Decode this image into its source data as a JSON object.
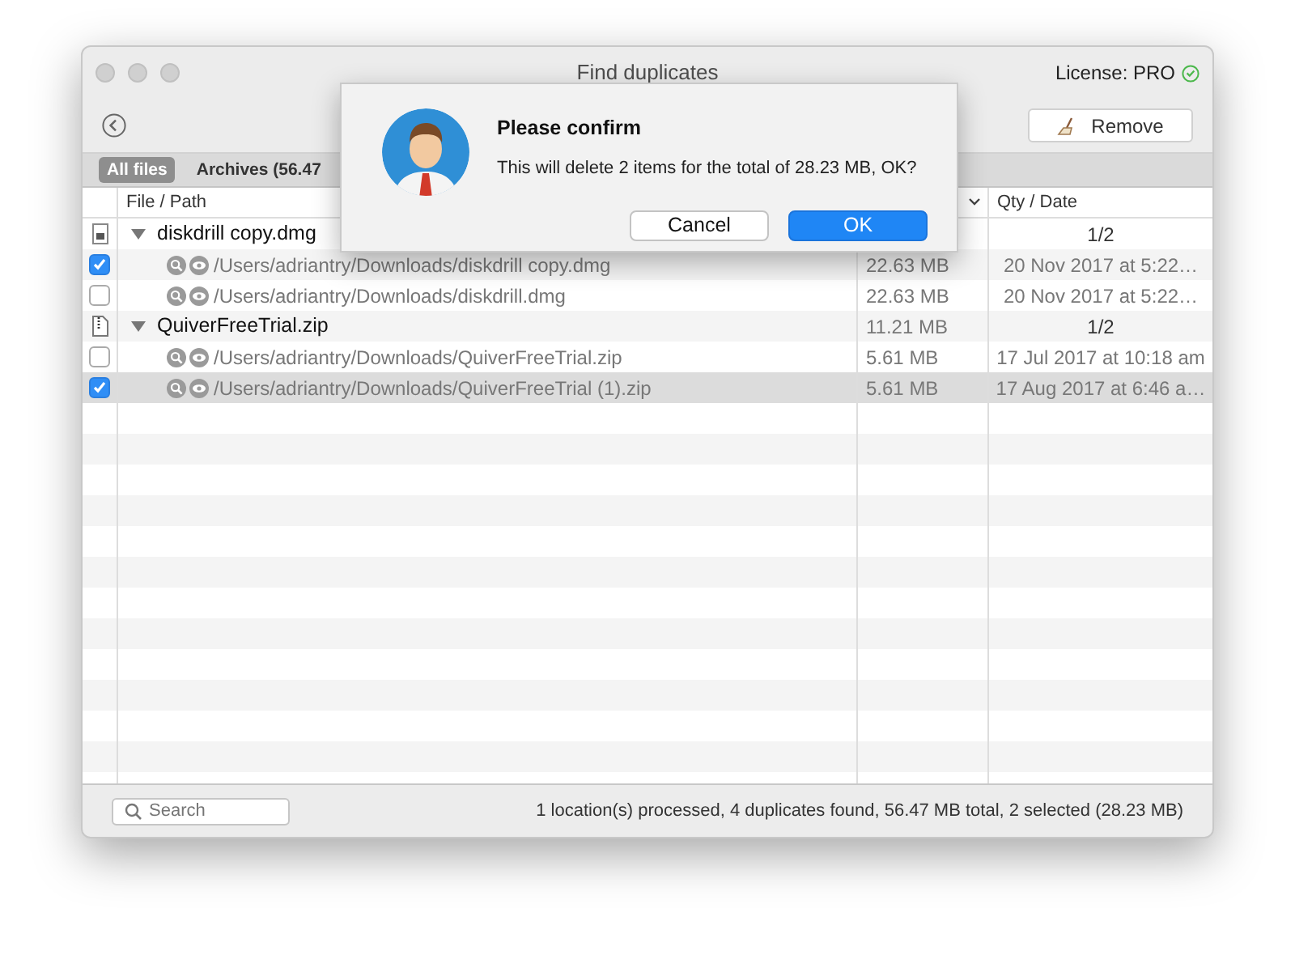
{
  "window": {
    "title": "Find duplicates",
    "license": "License: PRO"
  },
  "toolbar": {
    "remove_button": "Remove"
  },
  "tabs": [
    {
      "label": "All files",
      "selected": true
    },
    {
      "label": "Archives (56.47",
      "selected": false
    }
  ],
  "table": {
    "columns": {
      "path": "File / Path",
      "qty_date": "Qty / Date"
    },
    "rows": [
      {
        "kind": "dmg_group",
        "expanded": true,
        "name": "diskdrill copy.dmg",
        "qty": "1/2"
      },
      {
        "kind": "file",
        "checked": true,
        "selected": false,
        "path": "/Users/adriantry/Downloads/diskdrill copy.dmg",
        "size": "22.63 MB",
        "date": "20 Nov 2017 at 5:22…"
      },
      {
        "kind": "file",
        "checked": false,
        "selected": false,
        "path": "/Users/adriantry/Downloads/diskdrill.dmg",
        "size": "22.63 MB",
        "date": "20 Nov 2017 at 5:22…"
      },
      {
        "kind": "zip_group",
        "expanded": true,
        "name": "QuiverFreeTrial.zip",
        "size": "11.21 MB",
        "qty": "1/2"
      },
      {
        "kind": "file",
        "checked": false,
        "selected": false,
        "path": "/Users/adriantry/Downloads/QuiverFreeTrial.zip",
        "size": "5.61 MB",
        "date": "17 Jul 2017 at 10:18 am"
      },
      {
        "kind": "file",
        "checked": true,
        "selected": true,
        "path": "/Users/adriantry/Downloads/QuiverFreeTrial (1).zip",
        "size": "5.61 MB",
        "date": "17 Aug 2017 at 6:46 a…"
      }
    ]
  },
  "footer": {
    "search": {
      "placeholder": "Search"
    },
    "status": "1 location(s) processed, 4 duplicates found, 56.47 MB total, 2 selected (28.23 MB)"
  },
  "dialog": {
    "title": "Please confirm",
    "message": "This will delete 2 items for the total of 28.23 MB, OK?",
    "buttons": [
      {
        "label": "Cancel",
        "default": false
      },
      {
        "label": "OK",
        "default": true
      }
    ]
  }
}
